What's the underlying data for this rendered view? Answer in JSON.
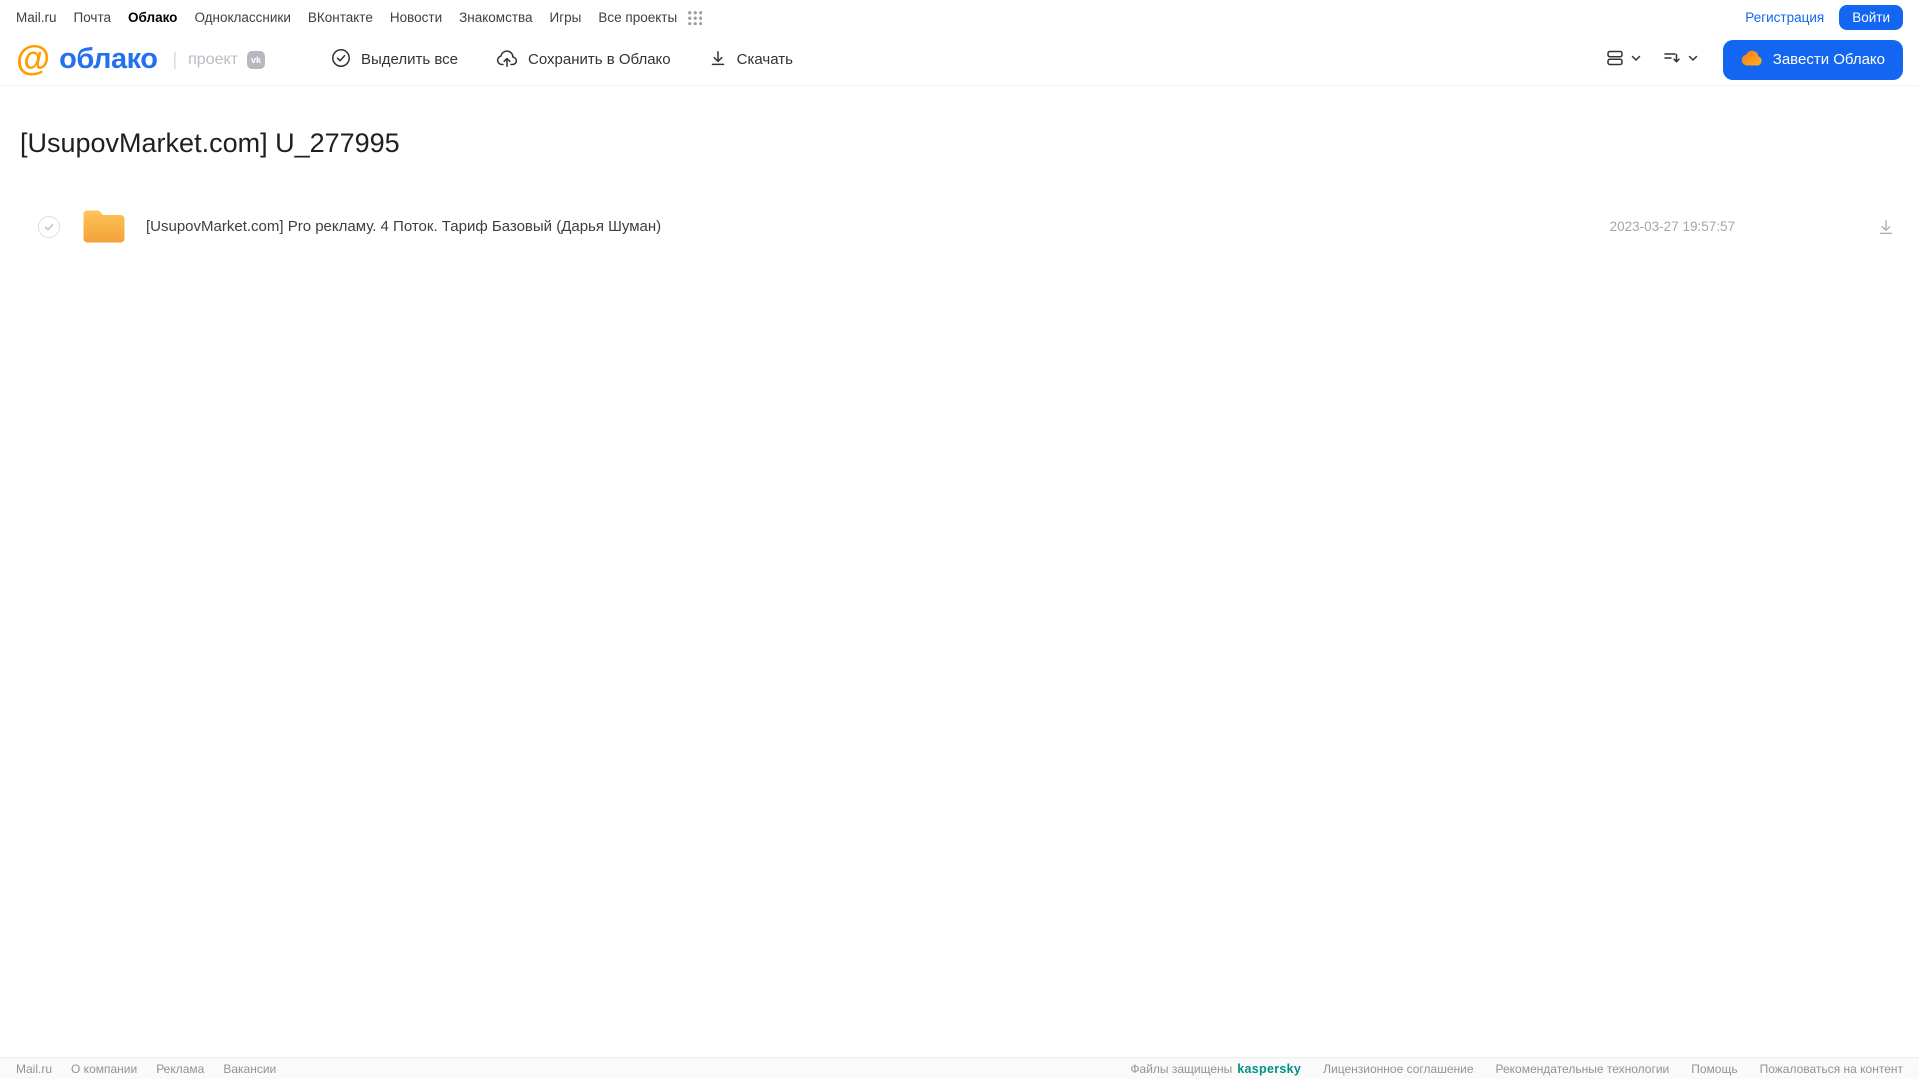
{
  "topnav": {
    "items": [
      "Mail.ru",
      "Почта",
      "Облако",
      "Одноклассники",
      "ВКонтакте",
      "Новости",
      "Знакомства",
      "Игры",
      "Все проекты"
    ],
    "active_item": "Облако",
    "registration_label": "Регистрация",
    "login_label": "Войти"
  },
  "header": {
    "logo": {
      "at_symbol": "@",
      "product_name": "облако",
      "divider": "|",
      "project_label": "проект",
      "vk_badge": "vk"
    },
    "toolbar": {
      "select_all_label": "Выделить все",
      "save_to_cloud_label": "Сохранить в Облако",
      "download_label": "Скачать"
    },
    "get_cloud_button_label": "Завести Облако"
  },
  "page": {
    "title": "[UsupovMarket.com] U_277995"
  },
  "file_list": {
    "rows": [
      {
        "type": "folder",
        "name": "[UsupovMarket.com] Pro рекламу. 4 Поток. Тариф Базовый (Дарья Шуман)",
        "modified": "2023-03-27 19:57:57"
      }
    ]
  },
  "footer": {
    "left_links": [
      "Mail.ru",
      "О компании",
      "Реклама",
      "Вакансии"
    ],
    "protected_text": "Файлы защищены",
    "kaspersky_brand": "kaspersky",
    "right_links": [
      "Лицензионное соглашение",
      "Рекомендательные технологии",
      "Помощь",
      "Пожаловаться на контент"
    ]
  },
  "colors": {
    "accent_blue": "#1266f1",
    "logo_orange": "#ff9e00",
    "logo_blue": "#2470f0",
    "folder_orange": "#f7b645",
    "kaspersky_teal": "#009284"
  }
}
